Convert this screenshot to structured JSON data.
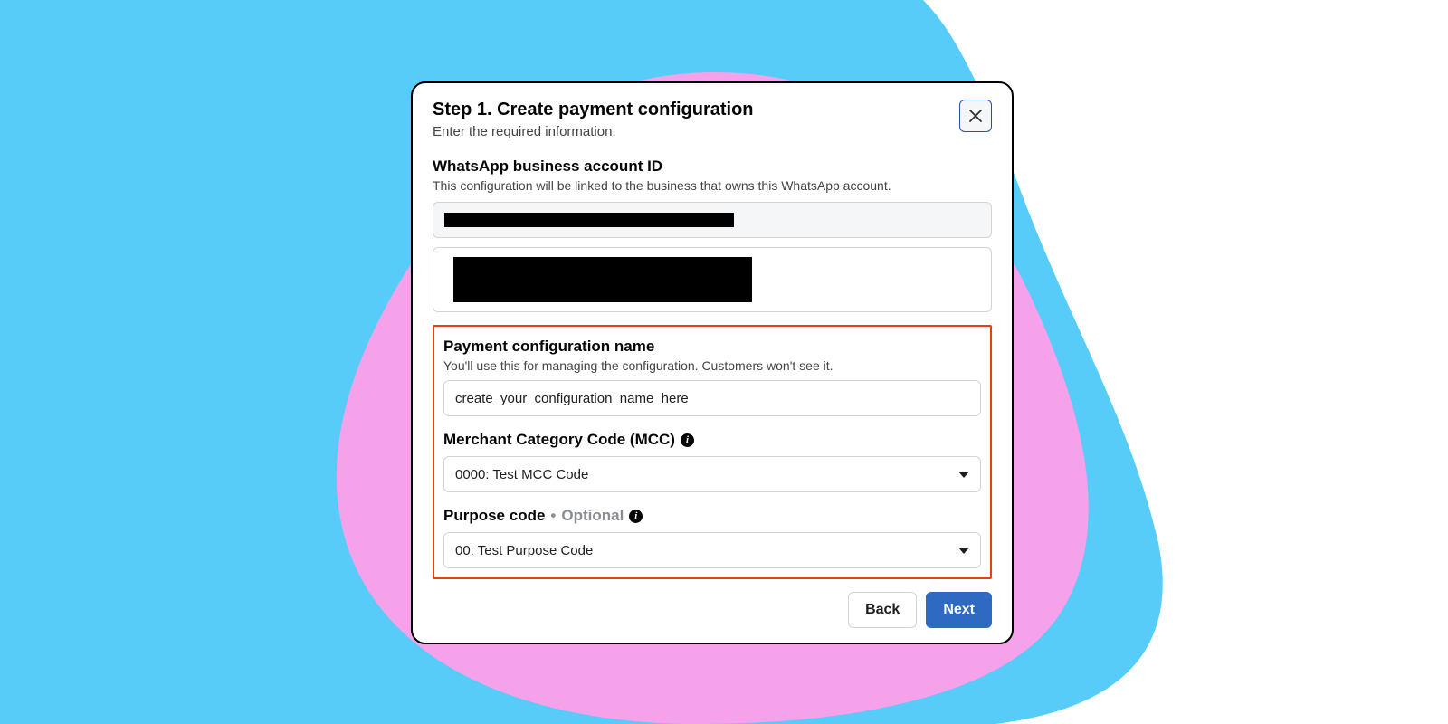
{
  "dialog": {
    "title": "Step 1. Create payment configuration",
    "subtitle": "Enter the required information."
  },
  "account": {
    "label": "WhatsApp business account ID",
    "desc": "This configuration will be linked to the business that owns this WhatsApp account."
  },
  "configName": {
    "label": "Payment configuration name",
    "desc": "You'll use this for managing the configuration. Customers won't see it.",
    "value": "create_your_configuration_name_here"
  },
  "mcc": {
    "label": "Merchant Category Code (MCC)",
    "value": "0000: Test MCC Code"
  },
  "purpose": {
    "label": "Purpose code",
    "optional": "Optional",
    "value": "00: Test Purpose Code"
  },
  "footer": {
    "back": "Back",
    "next": "Next"
  },
  "colors": {
    "bgBlue": "#58ccf9",
    "bgPink": "#f6a2ea",
    "highlight": "#e83e18",
    "primary": "#2e69c2"
  }
}
